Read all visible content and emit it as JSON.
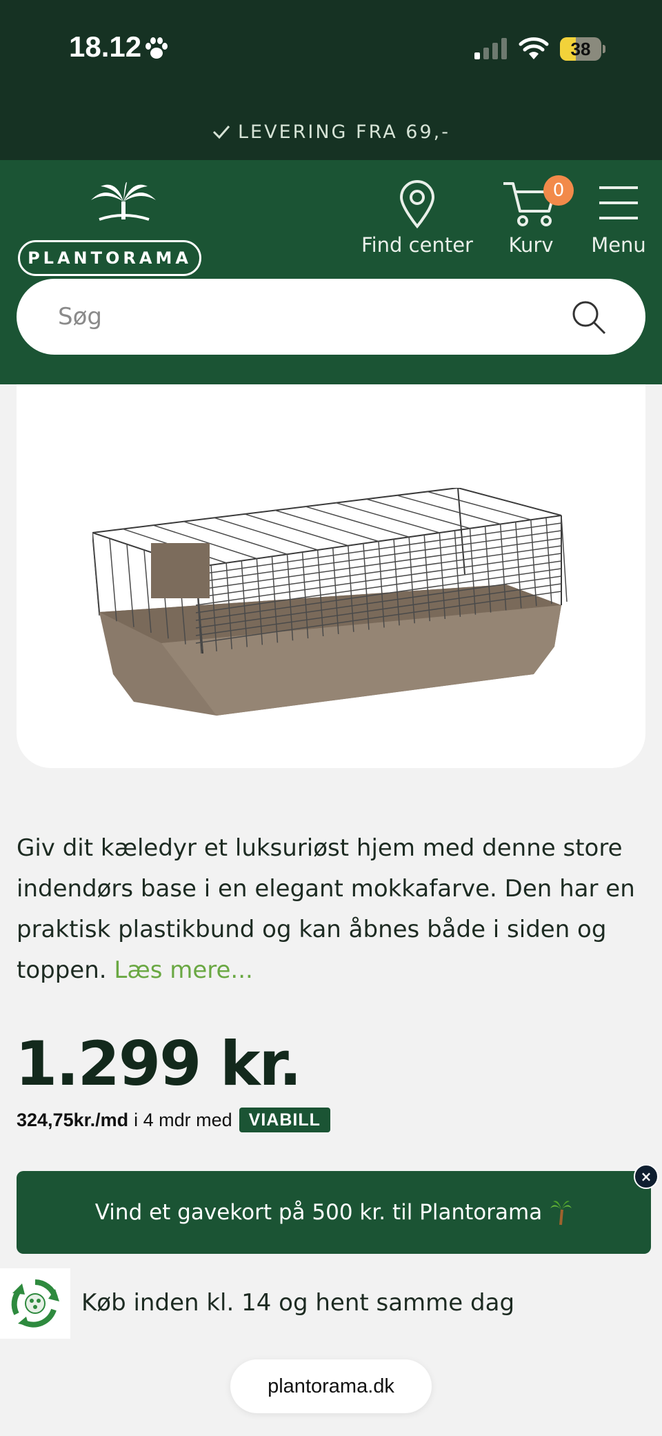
{
  "status_bar": {
    "time": "18.12",
    "battery": "38",
    "battery_level": 0.38
  },
  "delivery_banner": {
    "text": "LEVERING FRA 69,-"
  },
  "header": {
    "logo_text": "PLANTORAMA",
    "find_center_label": "Find center",
    "cart_label": "Kurv",
    "cart_count": "0",
    "menu_label": "Menu"
  },
  "search": {
    "placeholder": "Søg"
  },
  "product": {
    "image_alt": "hamster cage",
    "description": "Giv dit kæledyr et luksuriøst hjem med denne store indendørs base i en elegant mokkafarve. Den har en praktisk plastikbund og kan åbnes både i siden og toppen.",
    "read_more": "Læs mere...",
    "price": "1.299 kr.",
    "installment_amount": "324,75kr./md",
    "installment_text": "i 4 mdr med",
    "installment_provider": "VIABILL"
  },
  "promo": {
    "text": "Vind et gavekort på 500 kr. til Plantorama",
    "close": "×"
  },
  "pickup": {
    "text": "Køb inden kl. 14 og hent samme dag"
  },
  "browser": {
    "url": "plantorama.dk"
  },
  "colors": {
    "header_green": "#1b5434",
    "status_dark": "#163223",
    "accent_orange": "#f28a4a",
    "link_green": "#6aa843",
    "page_bg": "#f2f2f2"
  },
  "icons": [
    "paw-icon",
    "signal-icon",
    "wifi-icon",
    "check-icon",
    "location-pin-icon",
    "cart-icon",
    "menu-icon",
    "search-icon",
    "palm-tree-icon",
    "close-icon",
    "recycle-icon"
  ]
}
